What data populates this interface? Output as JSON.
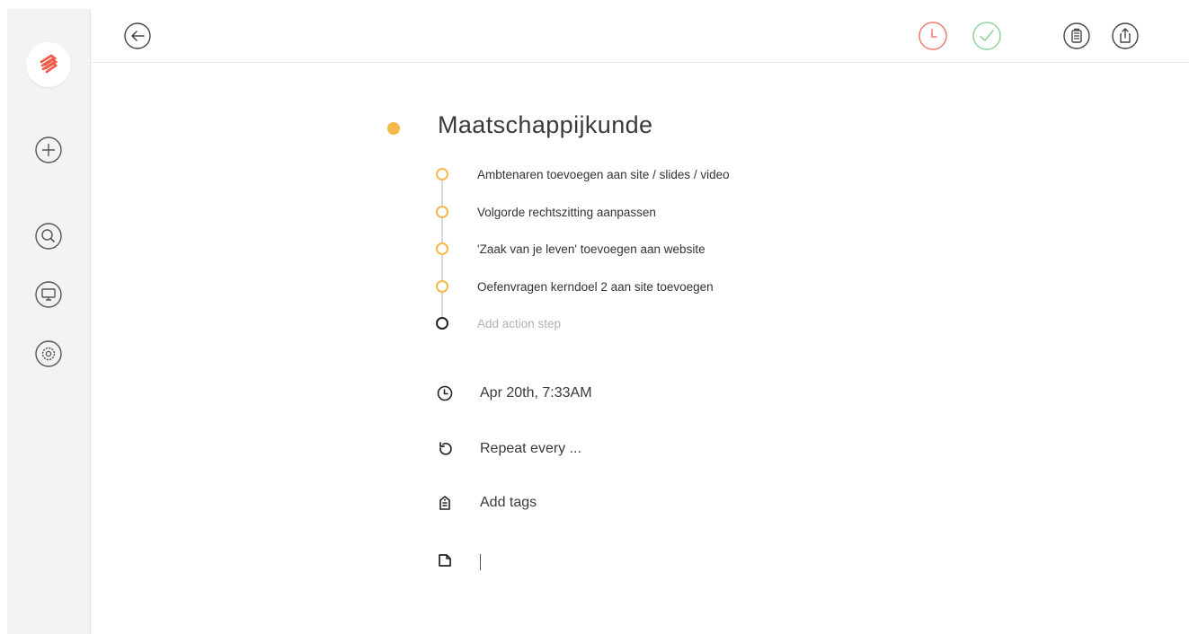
{
  "icons": {
    "logo": "app-logo",
    "add": "plus-circle-icon",
    "search": "search-icon",
    "monitor": "monitor-icon",
    "settings": "gear-icon",
    "back": "arrow-left-icon",
    "schedule": "clock-icon",
    "complete": "check-icon",
    "delete": "trash-icon",
    "share": "share-icon",
    "date": "clock-icon",
    "repeat": "repeat-icon",
    "tags": "tag-icon",
    "note": "note-icon"
  },
  "colors": {
    "accent": "#f5b94a",
    "logo_red": "#ef5a45",
    "clock_red": "#f07b72",
    "check_green": "#8fd49c"
  },
  "project": {
    "title": "Maatschappijkunde"
  },
  "action_steps": [
    {
      "label": "Ambtenaren toevoegen aan site / slides / video"
    },
    {
      "label": "Volgorde rechtszitting aanpassen"
    },
    {
      "label": "'Zaak van je leven' toevoegen aan website"
    },
    {
      "label": "Oefenvragen kerndoel 2 aan site toevoegen"
    }
  ],
  "add_step": {
    "placeholder": "Add action step"
  },
  "due_date": {
    "text": "Apr 20th, 7:33AM"
  },
  "repeat": {
    "text": "Repeat every ..."
  },
  "tags": {
    "text": "Add tags"
  }
}
